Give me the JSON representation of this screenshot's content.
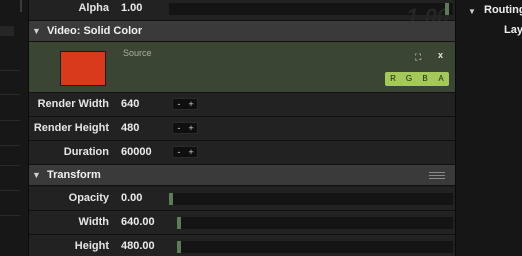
{
  "panel": {
    "alpha": {
      "label": "Alpha",
      "value": "1.00",
      "ghost": "1.00"
    },
    "video_section": {
      "title": "Video: Solid Color"
    },
    "source": {
      "label": "Source",
      "swatch_color": "#d93a1c",
      "expand_icon": "⛶",
      "close_icon": "x",
      "channels": [
        "R",
        "G",
        "B",
        "A"
      ]
    },
    "render_width": {
      "label": "Render Width",
      "value": "640",
      "minus": "-",
      "plus": "+"
    },
    "render_height": {
      "label": "Render Height",
      "value": "480",
      "minus": "-",
      "plus": "+"
    },
    "duration": {
      "label": "Duration",
      "value": "60000",
      "minus": "-",
      "plus": "+"
    },
    "transform_section": {
      "title": "Transform"
    },
    "opacity": {
      "label": "Opacity",
      "value": "0.00"
    },
    "width": {
      "label": "Width",
      "value": "640.00"
    },
    "height": {
      "label": "Height",
      "value": "480.00"
    }
  },
  "right_panel": {
    "routing": "Routing",
    "layer": "Lay"
  },
  "colors": {
    "accent_green": "#a4c85a",
    "source_bg": "#3b4533",
    "slider_knob": "#5d7a5a"
  }
}
